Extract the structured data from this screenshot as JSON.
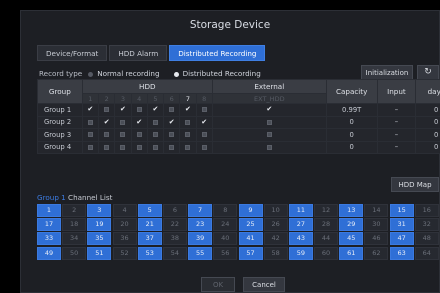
{
  "window": {
    "title": "Storage Device"
  },
  "tabs": [
    {
      "label": "Device/Format",
      "active": false
    },
    {
      "label": "HDD Alarm",
      "active": false
    },
    {
      "label": "Distributed Recording",
      "active": true
    }
  ],
  "record_type": {
    "label": "Record type",
    "options": [
      {
        "label": "Normal recording",
        "selected": false
      },
      {
        "label": "Distributed Recording",
        "selected": true
      }
    ]
  },
  "buttons": {
    "initialization": "Initialization",
    "refresh_icon": "refresh-icon",
    "hdd_map": "HDD Map",
    "ok": "OK",
    "cancel": "Cancel"
  },
  "table": {
    "headers": {
      "group": "Group",
      "hdd": "HDD",
      "external": "External",
      "capacity": "Capacity",
      "input": "Input",
      "days": "days"
    },
    "hdd_numbers": [
      "1",
      "2",
      "3",
      "4",
      "5",
      "6",
      "7",
      "8"
    ],
    "selected_hdd": "7",
    "external_sub": "EXT_HDD",
    "rows": [
      {
        "group": "Group 1",
        "hdd": [
          true,
          false,
          true,
          false,
          true,
          false,
          true,
          false
        ],
        "external": true,
        "capacity": "0.99T",
        "input": "–",
        "days": "0"
      },
      {
        "group": "Group 2",
        "hdd": [
          false,
          true,
          false,
          true,
          false,
          true,
          false,
          true
        ],
        "external": false,
        "capacity": "0",
        "input": "–",
        "days": "0"
      },
      {
        "group": "Group 3",
        "hdd": [
          false,
          false,
          false,
          false,
          false,
          false,
          false,
          false
        ],
        "external": false,
        "capacity": "0",
        "input": "–",
        "days": "0"
      },
      {
        "group": "Group 4",
        "hdd": [
          false,
          false,
          false,
          false,
          false,
          false,
          false,
          false
        ],
        "external": false,
        "capacity": "0",
        "input": "–",
        "days": "0"
      }
    ]
  },
  "channel_list": {
    "group_label": "Group 1",
    "title": "Channel List",
    "channels": [
      {
        "n": "1",
        "s": true
      },
      {
        "n": "2",
        "s": false
      },
      {
        "n": "3",
        "s": true
      },
      {
        "n": "4",
        "s": false
      },
      {
        "n": "5",
        "s": true
      },
      {
        "n": "6",
        "s": false
      },
      {
        "n": "7",
        "s": true
      },
      {
        "n": "8",
        "s": false
      },
      {
        "n": "9",
        "s": true
      },
      {
        "n": "10",
        "s": false
      },
      {
        "n": "11",
        "s": true
      },
      {
        "n": "12",
        "s": false
      },
      {
        "n": "13",
        "s": true
      },
      {
        "n": "14",
        "s": false
      },
      {
        "n": "15",
        "s": true
      },
      {
        "n": "16",
        "s": false
      },
      {
        "n": "17",
        "s": true
      },
      {
        "n": "18",
        "s": false
      },
      {
        "n": "19",
        "s": true
      },
      {
        "n": "20",
        "s": false
      },
      {
        "n": "21",
        "s": true
      },
      {
        "n": "22",
        "s": false
      },
      {
        "n": "23",
        "s": true
      },
      {
        "n": "24",
        "s": false
      },
      {
        "n": "25",
        "s": true
      },
      {
        "n": "26",
        "s": false
      },
      {
        "n": "27",
        "s": true
      },
      {
        "n": "28",
        "s": false
      },
      {
        "n": "29",
        "s": true
      },
      {
        "n": "30",
        "s": false
      },
      {
        "n": "31",
        "s": true
      },
      {
        "n": "32",
        "s": false
      },
      {
        "n": "33",
        "s": true
      },
      {
        "n": "34",
        "s": false
      },
      {
        "n": "35",
        "s": true
      },
      {
        "n": "36",
        "s": false
      },
      {
        "n": "37",
        "s": true
      },
      {
        "n": "38",
        "s": false
      },
      {
        "n": "39",
        "s": true
      },
      {
        "n": "40",
        "s": false
      },
      {
        "n": "41",
        "s": true
      },
      {
        "n": "42",
        "s": false
      },
      {
        "n": "43",
        "s": true
      },
      {
        "n": "44",
        "s": false
      },
      {
        "n": "45",
        "s": true
      },
      {
        "n": "46",
        "s": false
      },
      {
        "n": "47",
        "s": true
      },
      {
        "n": "48",
        "s": false
      },
      {
        "n": "49",
        "s": true
      },
      {
        "n": "50",
        "s": false
      },
      {
        "n": "51",
        "s": true
      },
      {
        "n": "52",
        "s": false
      },
      {
        "n": "53",
        "s": true
      },
      {
        "n": "54",
        "s": false
      },
      {
        "n": "55",
        "s": true
      },
      {
        "n": "56",
        "s": false
      },
      {
        "n": "57",
        "s": true
      },
      {
        "n": "58",
        "s": false
      },
      {
        "n": "59",
        "s": true
      },
      {
        "n": "60",
        "s": false
      },
      {
        "n": "61",
        "s": true
      },
      {
        "n": "62",
        "s": false
      },
      {
        "n": "63",
        "s": true
      },
      {
        "n": "64",
        "s": false
      }
    ]
  },
  "colors": {
    "accent": "#2f6fd6",
    "background": "#1d1f24",
    "header": "#3a3d44"
  }
}
